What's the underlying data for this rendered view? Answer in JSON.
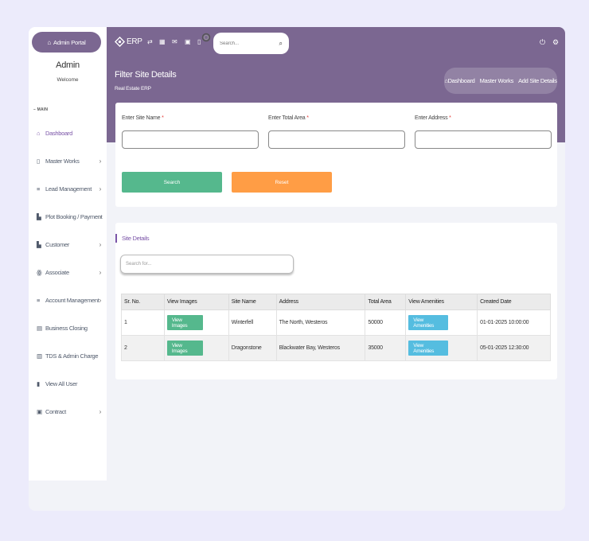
{
  "sidebar": {
    "portal_label": "Admin Portal",
    "user_name": "Admin",
    "welcome": "Welcome",
    "section": "MAIN",
    "items": [
      {
        "label": "Dashboard",
        "icon": "home-icon",
        "active": true
      },
      {
        "label": "Master Works",
        "icon": "tablet-icon",
        "chevron": true
      },
      {
        "label": "Lead Management",
        "icon": "list-icon",
        "chevron": true
      },
      {
        "label": "Plot Booking / Payment",
        "icon": "buildings-icon",
        "chevron": true
      },
      {
        "label": "Customer",
        "icon": "building-icon",
        "chevron": true
      },
      {
        "label": "Associate",
        "icon": "users-icon",
        "chevron": true
      },
      {
        "label": "Account Management",
        "icon": "list-icon",
        "chevron": true
      },
      {
        "label": "Business Closing",
        "icon": "ledger-icon"
      },
      {
        "label": "TDS & Admin Charge",
        "icon": "receipt-icon"
      },
      {
        "label": "View All User",
        "icon": "book-icon"
      },
      {
        "label": "Contract",
        "icon": "briefcase-icon",
        "chevron": true
      }
    ]
  },
  "topbar": {
    "logo_text": "ERP",
    "search_placeholder": "Search...",
    "page_title": "Filter Site Details",
    "page_subtitle": "Real Estate ERP",
    "breadcrumb": [
      "Dashboard",
      "Master Works",
      "Add Site Details"
    ]
  },
  "filter": {
    "site_name_label": "Enter Site Name",
    "total_area_label": "Enter Total Area",
    "address_label": "Enter Address",
    "required_mark": "*",
    "search_btn": "Search",
    "reset_btn": "Reset"
  },
  "details": {
    "title": "Site Details",
    "search_placeholder": "Search for...",
    "columns": [
      "Sr. No.",
      "View Images",
      "Site Name",
      "Address",
      "Total Area",
      "View Amenities",
      "Created Date"
    ],
    "rows": [
      {
        "sr": "1",
        "images_btn": "View Images",
        "site": "Winterfell",
        "address": "The North, Westeros",
        "area": "50000",
        "amenities_btn": "View Amenities",
        "created": "01-01-2025 10:00:00"
      },
      {
        "sr": "2",
        "images_btn": "View Images",
        "site": "Dragonstone",
        "address": "Blackwater Bay, Westeros",
        "area": "35000",
        "amenities_btn": "View Amenities",
        "created": "05-01-2025 12:30:00"
      }
    ]
  },
  "colors": {
    "brand": "#7b6791",
    "accent": "#7b55a8",
    "success": "#55b88d",
    "warning": "#ff9d45",
    "info": "#55bde0"
  }
}
